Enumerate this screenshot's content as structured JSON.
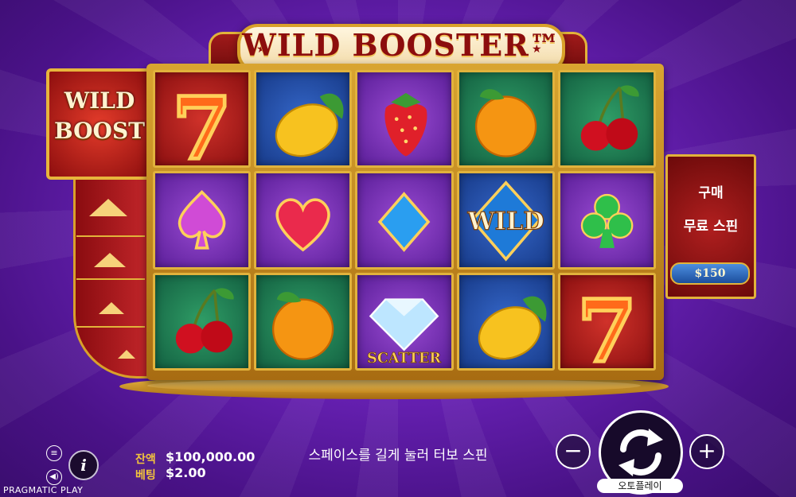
{
  "game": {
    "title": "WILD BOOSTER™",
    "provider": "PRAGMATIC PLAY"
  },
  "reels": {
    "symbols": [
      [
        "seven",
        "lemon",
        "strawberry",
        "orange",
        "cherries"
      ],
      [
        "spade",
        "heart",
        "diamond",
        "wild",
        "club"
      ],
      [
        "cherries",
        "orange",
        "scatter",
        "lemon",
        "seven"
      ]
    ],
    "wild_label": "WILD",
    "scatter_label": "SCATTER"
  },
  "wild_boost": {
    "line1": "WILD",
    "line2": "BOOST",
    "meter_icon": "up-arrow-icon"
  },
  "buy_feature": {
    "line1": "구매",
    "line2": "무료 스핀",
    "price": "$150"
  },
  "stats": {
    "balance_label": "잔액",
    "balance_value": "$100,000.00",
    "bet_label": "베팅",
    "bet_value": "$2.00"
  },
  "controls": {
    "hint": "스페이스를 길게 눌러 터보 스핀",
    "minus": "−",
    "plus": "+",
    "autoplay_label": "오토플레이",
    "info_icon": "i",
    "menu_icon": "≡",
    "sound_icon": "◀)",
    "spin_icon": "spin-arrows-icon"
  },
  "colors": {
    "gold": "#e2b33a",
    "title_red": "#8c0d0d",
    "label_gold": "#f2c43c"
  }
}
